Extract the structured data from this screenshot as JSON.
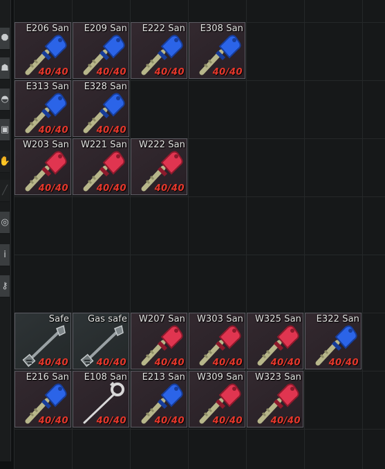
{
  "sidebar": {
    "icons": [
      "pin-icon",
      "character-icon",
      "helmet-icon",
      "backpack-icon",
      "gloves-icon",
      "weapon-icon",
      "grenade-icon",
      "info-icon",
      "key-icon"
    ]
  },
  "colors": {
    "blue_key": "#2b64e8",
    "red_key": "#e03550",
    "uses_text": "#e6372b",
    "item_border": "#5c5c63"
  },
  "items": [
    {
      "name": "E206 San",
      "uses": "40/40",
      "key": "blue"
    },
    {
      "name": "E209 San",
      "uses": "40/40",
      "key": "blue"
    },
    {
      "name": "E222 San",
      "uses": "40/40",
      "key": "blue"
    },
    {
      "name": "E308 San",
      "uses": "40/40",
      "key": "blue"
    },
    {
      "name": "E313 San",
      "uses": "40/40",
      "key": "blue"
    },
    {
      "name": "E328 San",
      "uses": "40/40",
      "key": "blue"
    },
    {
      "name": "W203 San",
      "uses": "40/40",
      "key": "red"
    },
    {
      "name": "W221 San",
      "uses": "40/40",
      "key": "red"
    },
    {
      "name": "W222 San",
      "uses": "40/40",
      "key": "red"
    },
    {
      "name": "Safe",
      "uses": "40/40",
      "key": "safe"
    },
    {
      "name": "Gas safe",
      "uses": "40/40",
      "key": "safe"
    },
    {
      "name": "W207 San",
      "uses": "40/40",
      "key": "red"
    },
    {
      "name": "W303 San",
      "uses": "40/40",
      "key": "red"
    },
    {
      "name": "W325 San",
      "uses": "40/40",
      "key": "red"
    },
    {
      "name": "E322 San",
      "uses": "40/40",
      "key": "blue"
    },
    {
      "name": "E216 San",
      "uses": "40/40",
      "key": "blue"
    },
    {
      "name": "E108 San",
      "uses": "40/40",
      "key": "skeleton"
    },
    {
      "name": "E213 San",
      "uses": "40/40",
      "key": "blue"
    },
    {
      "name": "W309 San",
      "uses": "40/40",
      "key": "red"
    },
    {
      "name": "W323 San",
      "uses": "40/40",
      "key": "red"
    }
  ]
}
